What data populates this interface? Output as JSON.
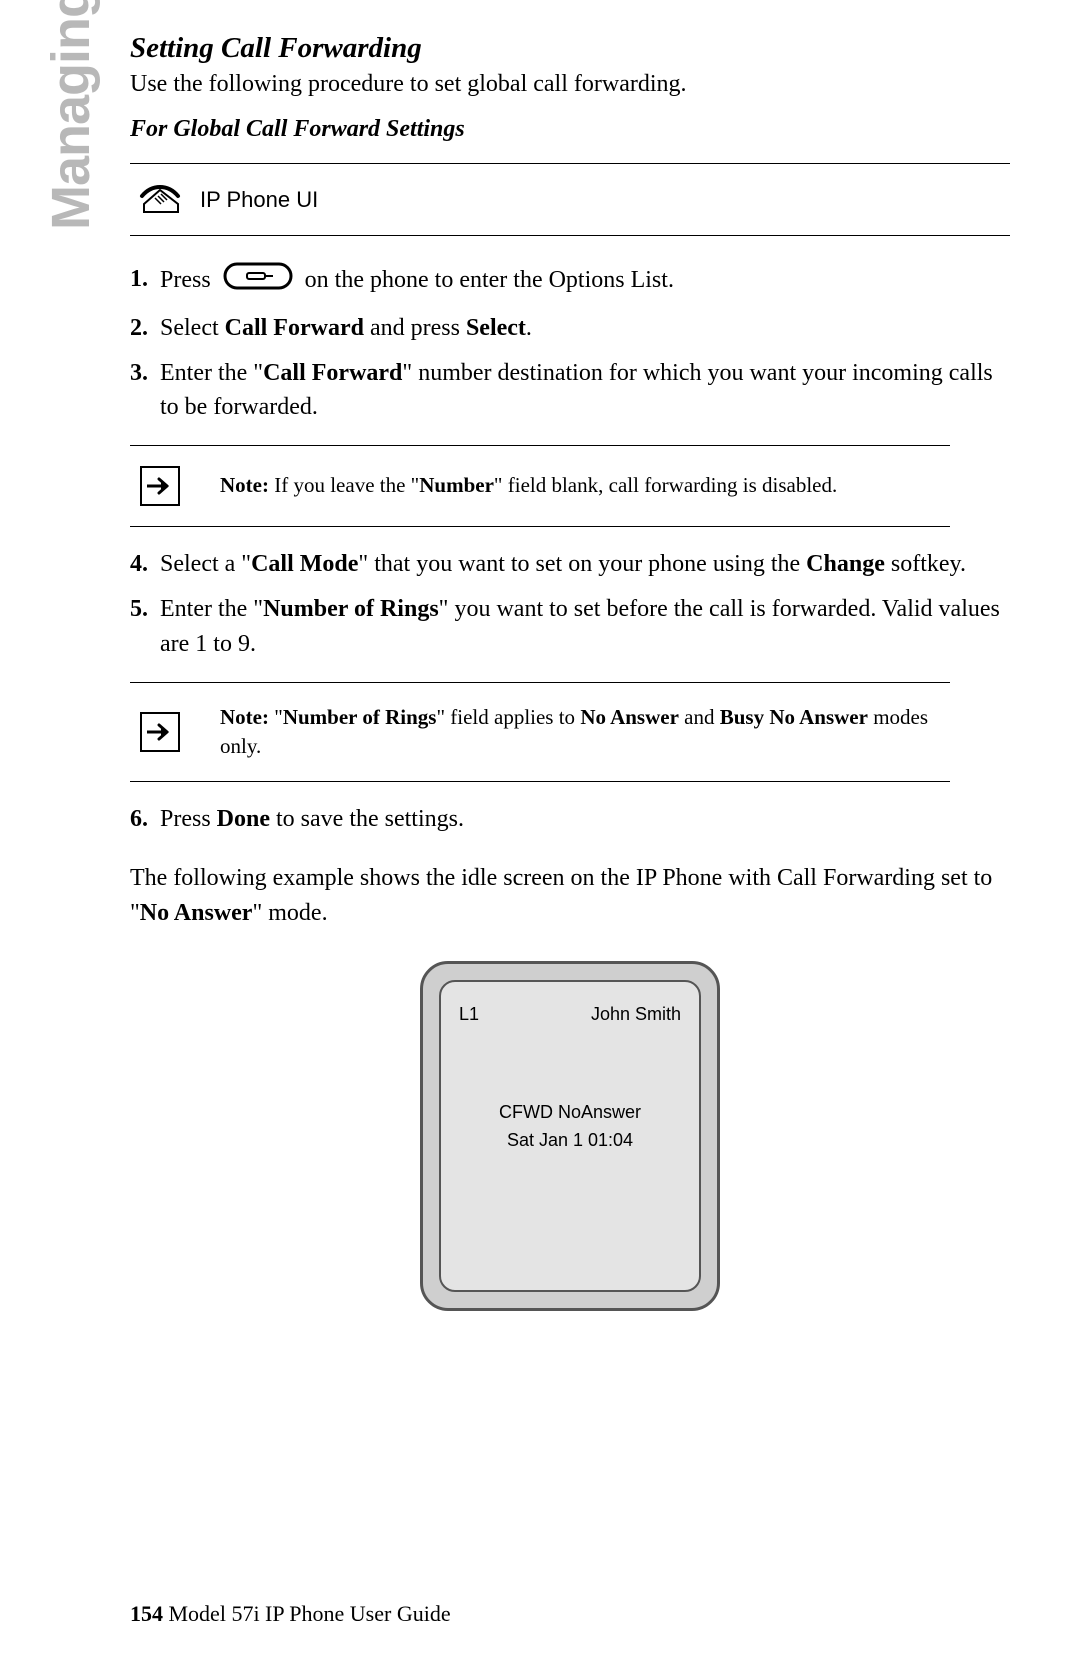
{
  "sideTab": "Managing Calls",
  "section": {
    "title": "Setting Call Forwarding",
    "intro": "Use the following procedure to set global call forwarding.",
    "subtitle": "For Global Call Forward Settings"
  },
  "uiRow": {
    "label": "IP Phone UI"
  },
  "steps": {
    "s1": {
      "num": "1.",
      "a": "Press",
      "b": "on the phone to enter the Options List."
    },
    "s2": {
      "num": "2.",
      "a": "Select ",
      "b": "Call Forward",
      "c": " and press ",
      "d": "Select",
      "e": "."
    },
    "s3": {
      "num": "3.",
      "a": "Enter the \"",
      "b": "Call Forward",
      "c": "\" number destination for which you want your incoming calls to be forwarded."
    },
    "s4": {
      "num": "4.",
      "a": "Select a \"",
      "b": "Call Mode",
      "c": "\" that you want to set on your phone using the ",
      "d": "Change",
      "e": " softkey."
    },
    "s5": {
      "num": "5.",
      "a": "Enter the \"",
      "b": "Number of Rings",
      "c": "\" you want to set before the call is forwarded. Valid values are 1 to 9."
    },
    "s6": {
      "num": "6.",
      "a": "Press ",
      "b": "Done",
      "c": " to save the settings."
    }
  },
  "notes": {
    "n1": {
      "a": "Note:",
      "b": " If you leave the \"",
      "c": "Number",
      "d": "\" field blank, call forwarding is disabled."
    },
    "n2": {
      "a": "Note:",
      "b": " \"",
      "c": "Number of Rings",
      "d": "\" field applies to ",
      "e": "No Answer",
      "f": " and ",
      "g": "Busy No Answer",
      "h": " modes only."
    }
  },
  "example": {
    "a": "The following example shows the idle screen on the IP Phone with Call Forwarding set to \"",
    "b": "No Answer",
    "c": "\" mode."
  },
  "phoneScreen": {
    "line": "L1",
    "name": "John Smith",
    "cfwd": "CFWD NoAnswer",
    "date": "Sat Jan 1 01:04"
  },
  "footer": {
    "page": "154",
    "title": " Model 57i IP Phone User Guide"
  }
}
